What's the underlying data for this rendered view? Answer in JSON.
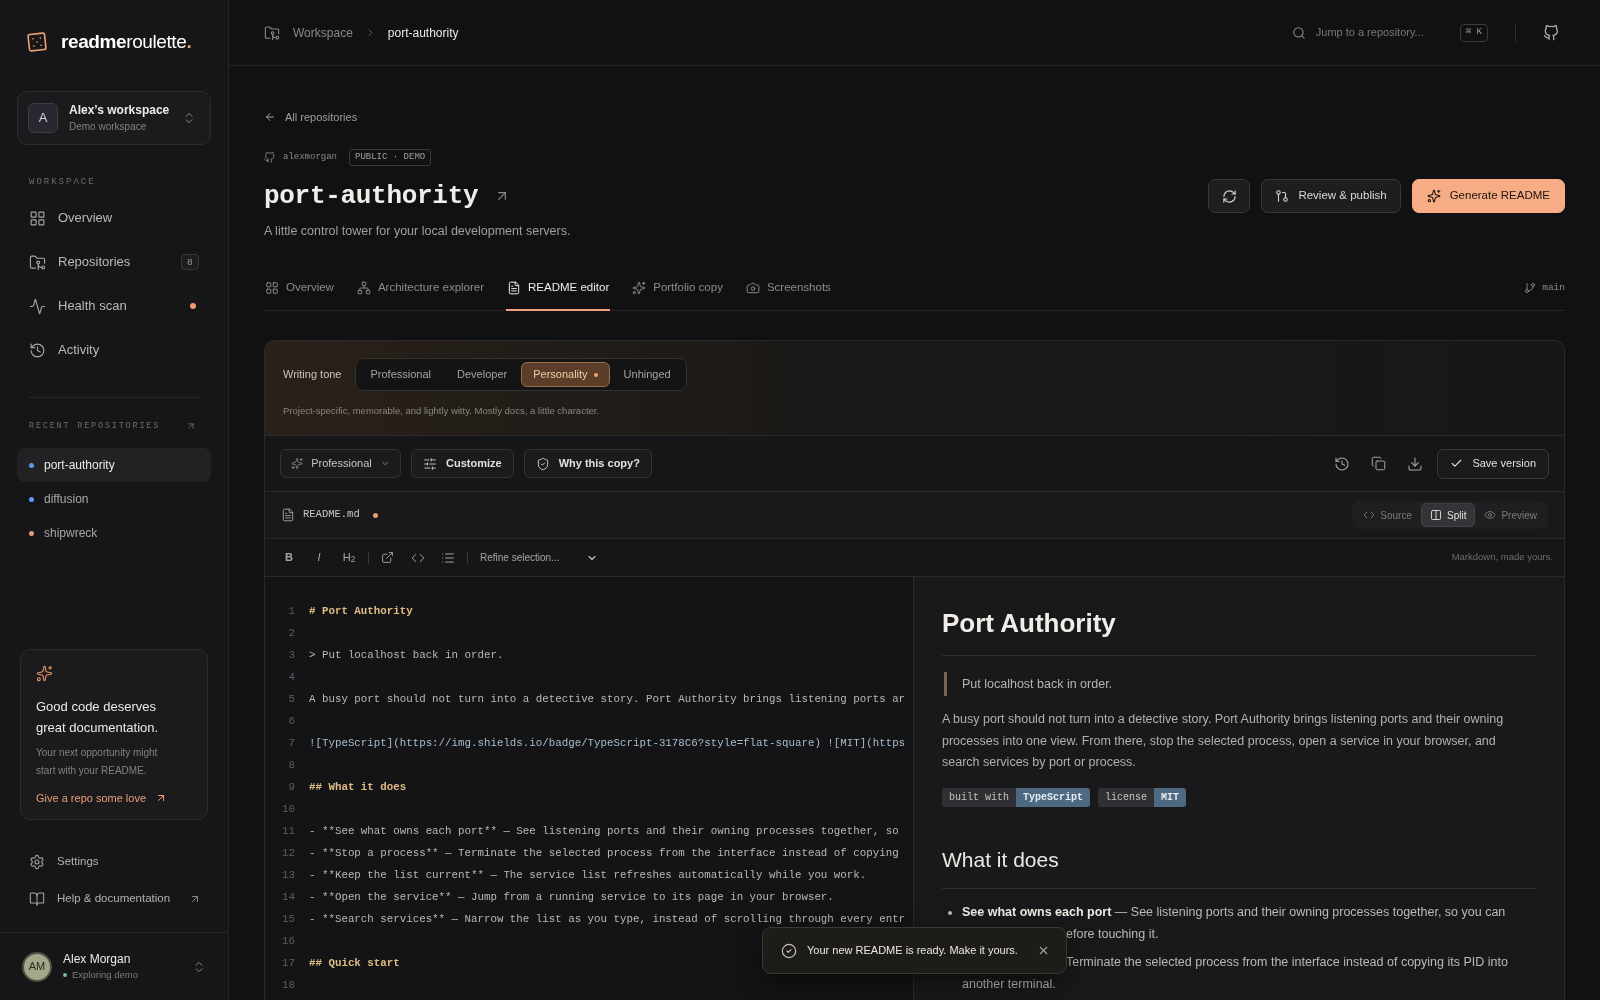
{
  "sidebar": {
    "logo": {
      "strong": "readme",
      "rest": "roulette",
      "dot": "."
    },
    "workspace": {
      "initial": "A",
      "name": "Alex’s workspace",
      "subtitle": "Demo workspace"
    },
    "section_label": "WORKSPACE",
    "nav": [
      {
        "label": "Overview",
        "selected": false,
        "dot": false
      },
      {
        "label": "Repositories",
        "badge": "8",
        "selected": false,
        "dot": false
      },
      {
        "label": "Health scan",
        "selected": false,
        "dot": true
      },
      {
        "label": "Activity",
        "selected": false,
        "dot": false
      }
    ],
    "recent_label": "RECENT REPOSITORIES",
    "recent": [
      {
        "name": "port-authority",
        "color": "#5b9bf0",
        "selected": true
      },
      {
        "name": "diffusion",
        "color": "#5b9bf0",
        "selected": false
      },
      {
        "name": "shipwreck",
        "color": "#e59a7e",
        "selected": false
      }
    ],
    "promo": {
      "title": "Good code deserves great documentation.",
      "body": "Your next opportunity might start with your README.",
      "link": "Give a repo some love"
    },
    "footer_nav": [
      {
        "label": "Settings",
        "external": false
      },
      {
        "label": "Help & documentation",
        "external": true
      }
    ],
    "user": {
      "initials": "AM",
      "name": "Alex Morgan",
      "status": "Exploring demo"
    }
  },
  "header": {
    "breadcrumb": [
      {
        "label": "Workspace",
        "current": false
      },
      {
        "label": "port-authority",
        "current": true
      }
    ],
    "search": {
      "placeholder": "Jump to a repository...",
      "shortcut": "⌘ K"
    }
  },
  "repo": {
    "back_link": "All repositories",
    "owner": "alexmorgan",
    "visibility": "PUBLIC · DEMO",
    "name": "port-authority",
    "description": "A little control tower for your local development servers.",
    "actions": [
      {
        "kind": "icon"
      },
      {
        "kind": "secondary",
        "label": "Review & publish"
      },
      {
        "kind": "primary",
        "label": "Generate README"
      }
    ]
  },
  "tabs": [
    {
      "label": "Overview",
      "selected": false
    },
    {
      "label": "Architecture explorer",
      "selected": false
    },
    {
      "label": "README editor",
      "selected": true
    },
    {
      "label": "Portfolio copy",
      "selected": false
    },
    {
      "label": "Screenshots",
      "selected": false
    }
  ],
  "branch": "main",
  "editor": {
    "tone": {
      "label": "Writing tone",
      "options": [
        {
          "label": "Professional",
          "selected": false
        },
        {
          "label": "Developer",
          "selected": false
        },
        {
          "label": "Personality",
          "selected": true
        },
        {
          "label": "Unhinged",
          "selected": false
        }
      ],
      "description": "Project-specific, memorable, and lightly witty. Mostly docs, a little character."
    },
    "toolbar": {
      "preset": "Professional",
      "buttons": [
        "Customize",
        "Why this copy?"
      ],
      "save": "Save version"
    },
    "file": {
      "name": "README.md",
      "unsaved": true,
      "views": [
        {
          "label": "Source",
          "selected": false
        },
        {
          "label": "Split",
          "selected": true
        },
        {
          "label": "Preview",
          "selected": false
        }
      ]
    },
    "format": {
      "marks": [
        {
          "kind": "bold",
          "label": "B"
        },
        {
          "kind": "italic",
          "label": "I"
        },
        {
          "kind": "heading",
          "label": "H$_{2}$"
        }
      ],
      "refine": "Refine selection...",
      "hint": "Markdown, made yours."
    },
    "code": [
      {
        "n": "1",
        "kind": "heading",
        "text": "# Port Authority"
      },
      {
        "n": "2",
        "kind": "blank"
      },
      {
        "n": "3",
        "kind": "quote",
        "text": "> Put localhost back in order."
      },
      {
        "n": "4",
        "kind": "blank"
      },
      {
        "n": "5",
        "kind": "text",
        "text": "A busy port should not turn into a detective story. Port Authority brings listening ports ar"
      },
      {
        "n": "6",
        "kind": "blank"
      },
      {
        "n": "7",
        "kind": "link",
        "text": "![TypeScript](https://img.shields.io/badge/TypeScript-3178C6?style=flat-square) ![MIT](https"
      },
      {
        "n": "8",
        "kind": "blank"
      },
      {
        "n": "9",
        "kind": "heading",
        "text": "## What it does"
      },
      {
        "n": "10",
        "kind": "blank"
      },
      {
        "n": "11",
        "kind": "list",
        "text": "- **See what owns each port** — See listening ports and their owning processes together, so"
      },
      {
        "n": "12",
        "kind": "list",
        "text": "- **Stop a process** — Terminate the selected process from the interface instead of copying"
      },
      {
        "n": "13",
        "kind": "list",
        "text": "- **Keep the list current** — The service list refreshes automatically while you work."
      },
      {
        "n": "14",
        "kind": "list",
        "text": "- **Open the service** — Jump from a running service to its page in your browser."
      },
      {
        "n": "15",
        "kind": "list",
        "text": "- **Search services** — Narrow the list as you type, instead of scrolling through every entr"
      },
      {
        "n": "16",
        "kind": "blank"
      },
      {
        "n": "17",
        "kind": "heading",
        "text": "## Quick start"
      },
      {
        "n": "18",
        "kind": "blank"
      }
    ],
    "preview": {
      "title": "Port Authority",
      "quote": "Put localhost back in order.",
      "paragraph": "A busy port should not turn into a detective story. Port Authority brings listening ports and their owning processes into one view. From there, stop the selected process, open a service in your browser, and search services by port or process.",
      "badges": [
        {
          "label": "built with",
          "value": "TypeScript"
        },
        {
          "label": "license",
          "value": "MIT"
        }
      ],
      "heading": "What it does",
      "items": [
        {
          "kind": "tail_covered",
          "text": "**See what owns each port** — See listening ports and their owning processes together, so you can",
          "tail": "efore touching it."
        },
        {
          "kind": "head_covered",
          "text": "Terminate the selected process from the interface instead of copying its PID into",
          "tail": "another terminal."
        }
      ]
    }
  },
  "toast": {
    "message": "Your new README is ready. Make it yours."
  }
}
